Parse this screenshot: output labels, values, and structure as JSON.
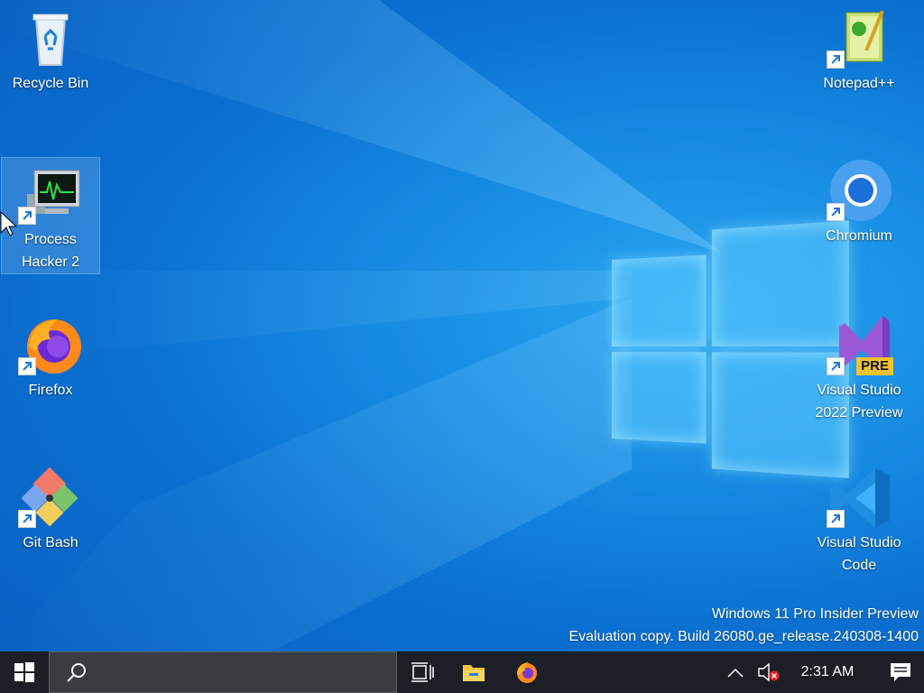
{
  "desktop": {
    "icons_left": [
      {
        "label": "Recycle Bin"
      },
      {
        "label": "Process Hacker 2"
      },
      {
        "label": "Firefox"
      },
      {
        "label": "Git Bash"
      }
    ],
    "icons_right": [
      {
        "label": "Notepad++"
      },
      {
        "label": "Chromium"
      },
      {
        "label": "Visual Studio 2022 Preview",
        "badge": "PRE"
      },
      {
        "label": "Visual Studio Code"
      }
    ],
    "watermark": {
      "line1": "Windows 11 Pro Insider Preview",
      "line2": "Evaluation copy. Build 26080.ge_release.240308-1400"
    }
  },
  "taskbar": {
    "search_placeholder": "",
    "clock": "2:31 AM"
  },
  "colors": {
    "taskbar": "#1c1f26",
    "wallpaper_accent": "#1488e0"
  }
}
